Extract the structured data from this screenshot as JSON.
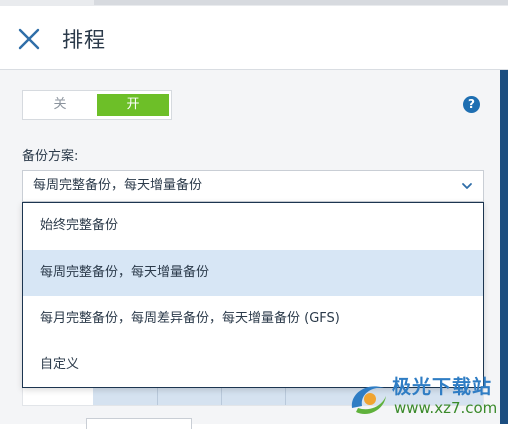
{
  "header": {
    "title": "排程",
    "close_icon": "close-icon"
  },
  "schedule_toggle": {
    "off_label": "关",
    "on_label": "开",
    "state": "on",
    "active_color": "#6dbf28"
  },
  "help": {
    "glyph": "?",
    "icon": "help-icon"
  },
  "backup_scheme": {
    "label": "备份方案:",
    "selected_value": "每周完整备份，每天增量备份",
    "options": [
      "始终完整备份",
      "每周完整备份，每天增量备份",
      "每月完整备份，每周差异备份，每天增量备份 (GFS)",
      "自定义"
    ],
    "selected_index": 1
  },
  "watermark": {
    "title": "极光下载站",
    "url": "www.xz7.com"
  },
  "colors": {
    "accent": "#1f6fb2",
    "rail": "#1c4e80",
    "selection": "#d7e6f5"
  }
}
